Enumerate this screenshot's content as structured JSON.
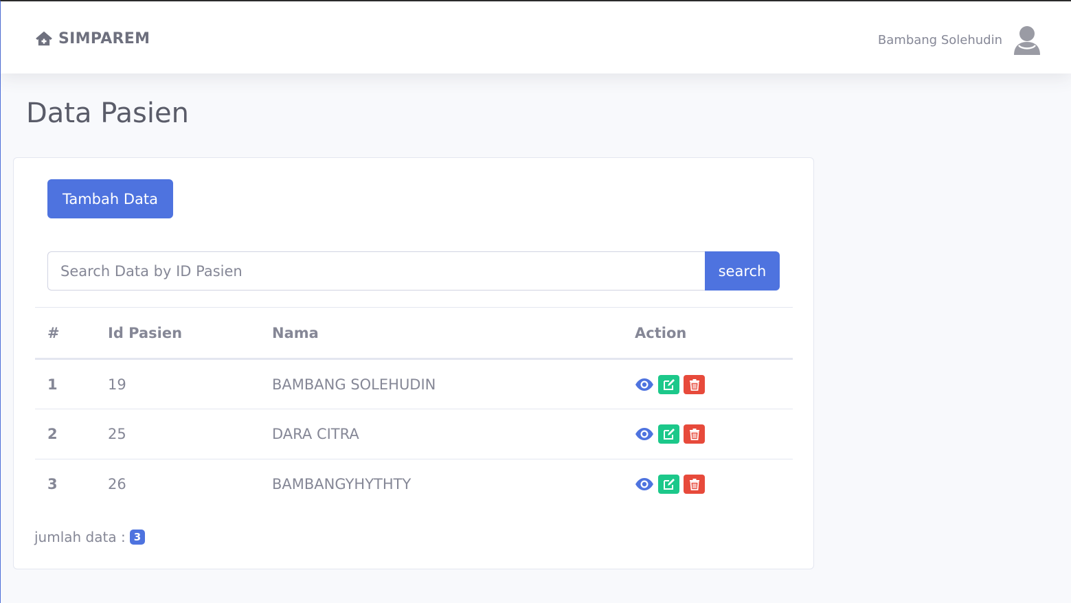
{
  "brand": {
    "name": "SIMPAREM",
    "icon": "home-icon"
  },
  "user": {
    "name": "Bambang Solehudin",
    "icon": "avatar-icon"
  },
  "page": {
    "title": "Data Pasien"
  },
  "actions_bar": {
    "add_label": "Tambah Data"
  },
  "search": {
    "placeholder": "Search Data by ID Pasien",
    "value": "",
    "button_label": "search"
  },
  "table": {
    "headers": [
      "#",
      "Id Pasien",
      "Nama",
      "Action"
    ],
    "rows": [
      {
        "num": "1",
        "id": "19",
        "name": "BAMBANG SOLEHUDIN"
      },
      {
        "num": "2",
        "id": "25",
        "name": "DARA CITRA"
      },
      {
        "num": "3",
        "id": "26",
        "name": "BAMBANGYHYTHTY"
      }
    ],
    "row_actions": [
      "eye-icon",
      "edit-icon",
      "trash-icon"
    ]
  },
  "footer": {
    "count_label": "jumlah data :",
    "count_value": "3"
  },
  "colors": {
    "primary": "#4e73df",
    "success": "#1cc88a",
    "danger": "#e74a3b",
    "text": "#858796"
  }
}
